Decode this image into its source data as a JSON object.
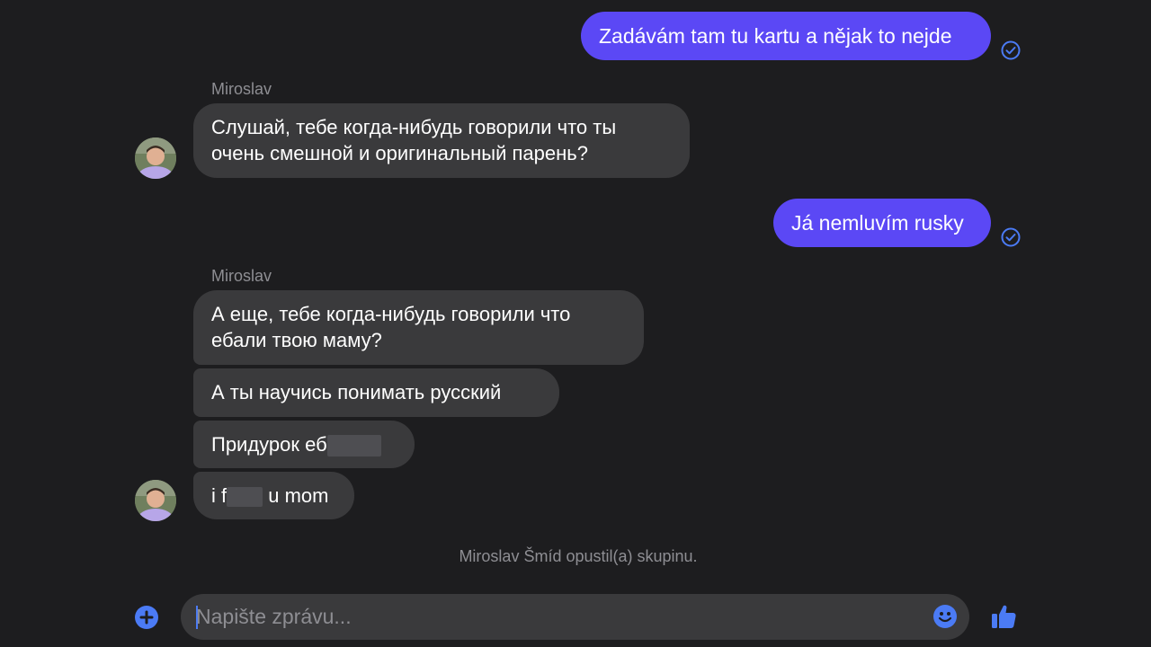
{
  "conversation": {
    "messages": [
      {
        "direction": "outgoing",
        "text": "Zadávám tam tu kartu a nějak to nejde",
        "status": "sent"
      },
      {
        "direction": "incoming",
        "sender": "Miroslav",
        "lines": [
          "Слушай, тебе когда-нибудь говорили что ты",
          "очень смешной и оригинальный парень?"
        ]
      },
      {
        "direction": "outgoing",
        "text": "Já nemluvím rusky",
        "status": "sent"
      },
      {
        "direction": "incoming",
        "sender": "Miroslav",
        "lines": [
          "А еще, тебе когда-нибудь говорили что",
          "ебали твою маму?"
        ]
      },
      {
        "direction": "incoming",
        "text": "А ты научись понимать русский"
      },
      {
        "direction": "incoming",
        "text_before_redaction": "Придурок еб"
      },
      {
        "direction": "incoming",
        "text_before_redaction": "i f",
        "text_after_redaction": " u mom"
      }
    ],
    "system_message": "Miroslav Šmíd opustil(a) skupinu."
  },
  "composer": {
    "placeholder": "Napište zprávu...",
    "value": ""
  },
  "icons": {
    "add": "plus-circle-icon",
    "emoji": "smiley-icon",
    "like": "thumbs-up-icon",
    "sent": "check-circle-icon"
  },
  "colors": {
    "background": "#1d1d1f",
    "outgoing_bubble": "#5b48f5",
    "incoming_bubble": "#3a3a3c",
    "accent": "#4b7bf5",
    "secondary_text": "#8e8e93"
  }
}
